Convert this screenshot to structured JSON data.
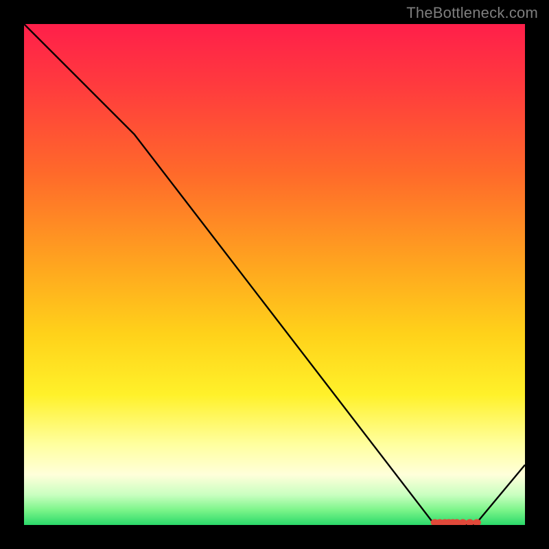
{
  "watermark": "TheBottleneck.com",
  "chart_data": {
    "type": "line",
    "title": "",
    "xlabel": "",
    "ylabel": "",
    "xlim": [
      0,
      100
    ],
    "ylim": [
      0,
      100
    ],
    "series": [
      {
        "name": "curve",
        "x": [
          0,
          22,
          82,
          90,
          100
        ],
        "y": [
          100,
          78,
          0,
          0,
          12
        ]
      }
    ],
    "markers": {
      "name": "flat-segment-dots",
      "color": "#e0493a",
      "points": [
        {
          "x": 82,
          "y": 0.5
        },
        {
          "x": 83,
          "y": 0.5
        },
        {
          "x": 84,
          "y": 0.5
        },
        {
          "x": 84.8,
          "y": 0.5
        },
        {
          "x": 85.6,
          "y": 0.5
        },
        {
          "x": 86.4,
          "y": 0.5
        },
        {
          "x": 87.6,
          "y": 0.5
        },
        {
          "x": 89.0,
          "y": 0.5
        },
        {
          "x": 90.4,
          "y": 0.5
        }
      ]
    }
  }
}
